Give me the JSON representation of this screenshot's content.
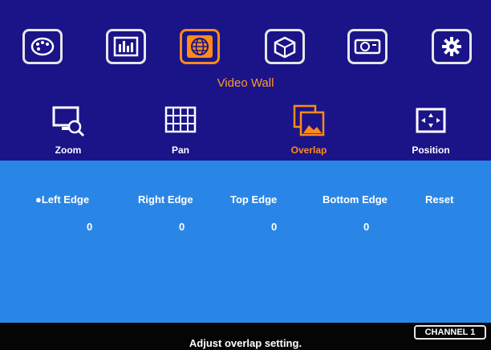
{
  "header": {
    "tabs": [
      {
        "icon": "palette-icon"
      },
      {
        "icon": "equalizer-icon"
      },
      {
        "icon": "globe-icon",
        "active": true
      },
      {
        "icon": "3d-cube-icon"
      },
      {
        "icon": "projector-icon"
      },
      {
        "icon": "gear-icon"
      }
    ],
    "title": "Video Wall"
  },
  "submenu": [
    {
      "label": "Zoom",
      "icon": "monitor-zoom-icon"
    },
    {
      "label": "Pan",
      "icon": "grid-pan-icon"
    },
    {
      "label": "Overlap",
      "icon": "overlap-icon",
      "active": true
    },
    {
      "label": "Position",
      "icon": "position-icon"
    }
  ],
  "options": {
    "left_edge": "●Left Edge",
    "right_edge": "Right Edge",
    "top_edge": "Top Edge",
    "bottom_edge": "Bottom Edge",
    "reset": "Reset"
  },
  "values": {
    "left_edge": "0",
    "right_edge": "0",
    "top_edge": "0",
    "bottom_edge": "0"
  },
  "status": {
    "hint": "Adjust overlap setting.",
    "channel": "CHANNEL 1"
  },
  "colors": {
    "top_background": "#1a1488",
    "panel_background": "#2a86e6",
    "accent": "#ff8a1a"
  }
}
